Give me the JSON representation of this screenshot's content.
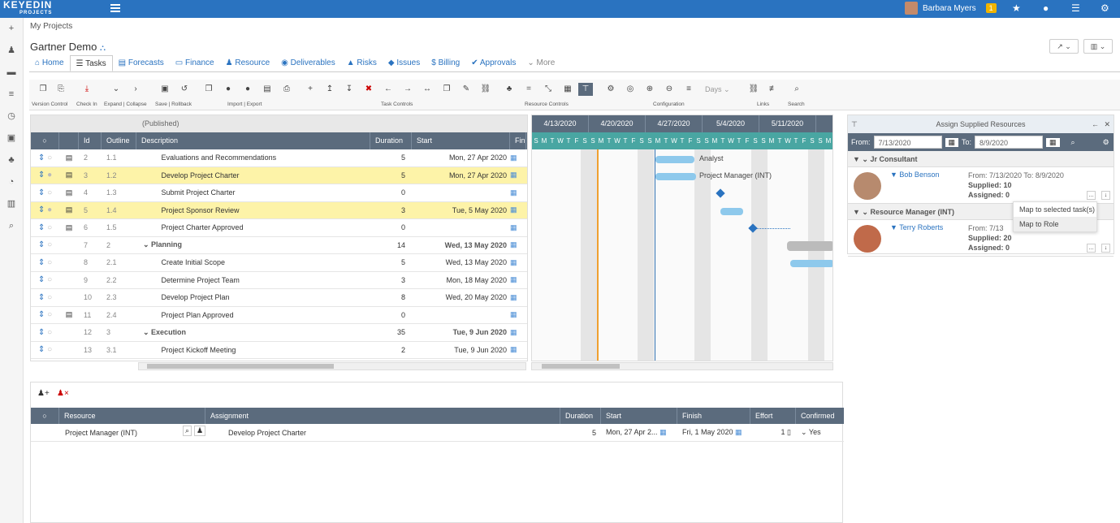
{
  "app": {
    "logo": "KEYEDIN",
    "logo_sub": "PROJECTS",
    "user": "Barbara Myers",
    "notif_count": "1"
  },
  "crumb": "My Projects",
  "title": "Gartner Demo",
  "tabs": [
    "Home",
    "Tasks",
    "Forecasts",
    "Finance",
    "Resource",
    "Deliverables",
    "Risks",
    "Issues",
    "Billing",
    "Approvals",
    "More"
  ],
  "toolbar": {
    "groups": [
      "Version Control",
      "Check In",
      "Expand | Collapse",
      "Save | Rollback",
      "Import | Export",
      "Task Controls",
      "Resource Controls",
      "Configuration",
      "Links",
      "Search"
    ],
    "days": "Days"
  },
  "grid": {
    "published": "(Published)",
    "headers": [
      "Id",
      "Outline",
      "Description",
      "Duration",
      "Start",
      "Fin"
    ],
    "rows": [
      {
        "id": "2",
        "outline": "1.1",
        "desc": "Evaluations and Recommendations",
        "dur": "5",
        "start": "Mon, 27 Apr 2020"
      },
      {
        "id": "3",
        "outline": "1.2",
        "desc": "Develop Project Charter",
        "dur": "5",
        "start": "Mon, 27 Apr 2020"
      },
      {
        "id": "4",
        "outline": "1.3",
        "desc": "Submit Project Charter",
        "dur": "0",
        "start": ""
      },
      {
        "id": "5",
        "outline": "1.4",
        "desc": "Project Sponsor Review",
        "dur": "3",
        "start": "Tue, 5 May 2020"
      },
      {
        "id": "6",
        "outline": "1.5",
        "desc": "Project Charter Approved",
        "dur": "0",
        "start": ""
      },
      {
        "id": "7",
        "outline": "2",
        "desc": "Planning",
        "dur": "14",
        "start": "Wed, 13 May 2020"
      },
      {
        "id": "8",
        "outline": "2.1",
        "desc": "Create Initial Scope",
        "dur": "5",
        "start": "Wed, 13 May 2020"
      },
      {
        "id": "9",
        "outline": "2.2",
        "desc": "Determine Project Team",
        "dur": "3",
        "start": "Mon, 18 May 2020"
      },
      {
        "id": "10",
        "outline": "2.3",
        "desc": "Develop Project Plan",
        "dur": "8",
        "start": "Wed, 20 May 2020"
      },
      {
        "id": "11",
        "outline": "2.4",
        "desc": "Project Plan Approved",
        "dur": "0",
        "start": ""
      },
      {
        "id": "12",
        "outline": "3",
        "desc": "Execution",
        "dur": "35",
        "start": "Tue, 9 Jun 2020"
      },
      {
        "id": "13",
        "outline": "3.1",
        "desc": "Project Kickoff Meeting",
        "dur": "2",
        "start": "Tue, 9 Jun 2020"
      }
    ]
  },
  "gantt": {
    "weeks": [
      "4/13/2020",
      "4/20/2020",
      "4/27/2020",
      "5/4/2020",
      "5/11/2020"
    ],
    "days": "SMTWTFSSMTWTFSSMTWTFSSMTWTFSSMTWTFSSM",
    "labels": [
      "Analyst",
      "Project Manager (INT)"
    ]
  },
  "bottom": {
    "headers": [
      "Resource",
      "Assignment",
      "Duration",
      "Start",
      "Finish",
      "Effort",
      "Confirmed"
    ],
    "row": {
      "resource": "Project Manager (INT)",
      "assignment": "Develop Project Charter",
      "dur": "5",
      "start": "Mon, 27 Apr 2...",
      "finish": "Fri, 1 May 2020",
      "effort": "1",
      "confirmed": "Yes"
    }
  },
  "panel": {
    "title": "Assign Supplied Resources",
    "from_label": "From:",
    "from": "7/13/2020",
    "to_label": "To:",
    "to": "8/9/2020",
    "groups": [
      {
        "name": "Jr Consultant",
        "person": "Bob Benson",
        "from": "From: 7/13/2020",
        "to": "To: 8/9/2020",
        "supplied": "Supplied: 10",
        "assigned": "Assigned: 0"
      },
      {
        "name": "Resource Manager (INT)",
        "person": "Terry Roberts",
        "from": "From: 7/13",
        "supplied": "Supplied: 20",
        "assigned": "Assigned: 0"
      }
    ],
    "menu": [
      "Map to selected task(s)",
      "Map to Role"
    ]
  }
}
